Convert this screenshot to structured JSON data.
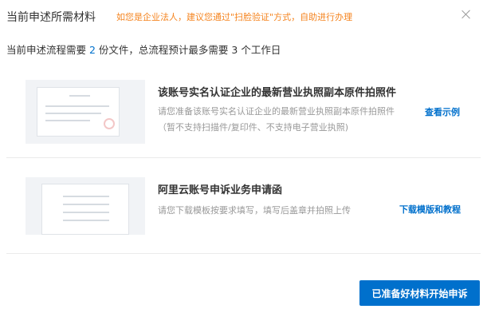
{
  "dialog": {
    "title": "当前申述所需材料",
    "notice": "如您是企业法人，建议您通过\"扫脸验证\"方式，自助进行办理",
    "close_icon": "close-icon"
  },
  "summary": {
    "prefix": "当前申述流程需要 ",
    "file_count": "2",
    "middle": " 份文件，总流程预计最多需要 ",
    "days": "3",
    "suffix": " 个工作日"
  },
  "materials": [
    {
      "title": "该账号实名认证企业的最新营业执照副本原件拍照件",
      "description": "请您准备该账号实名认证企业的最新营业执照副本原件拍照件（暂不支持扫描件/复印件、不支持电子营业执照)",
      "link": "查看示例",
      "thumbnail_icon": "business-license-thumbnail"
    },
    {
      "title": "阿里云账号申诉业务申请函",
      "description": "请您下载模板按要求填写，填写后盖章并拍照上传",
      "link": "下载模版和教程",
      "thumbnail_icon": "application-letter-thumbnail"
    }
  ],
  "actions": {
    "primary": "已准备好材料开始申诉"
  },
  "colors": {
    "accent": "#0070cc",
    "notice": "#f5841f",
    "muted_text": "#999999"
  }
}
